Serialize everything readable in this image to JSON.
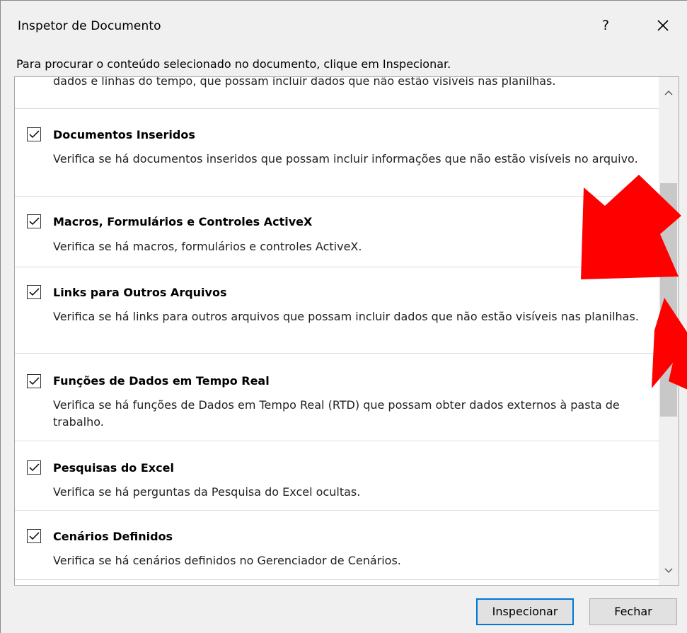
{
  "window": {
    "title": "Inspetor de Documento",
    "help_label": "?"
  },
  "instructions": "Para procurar o conteúdo selecionado no documento, clique em Inspecionar.",
  "list": {
    "cut_text": "dados e linhas do tempo, que possam incluir dados que não estão visíveis nas planilhas.",
    "items": [
      {
        "title": "Documentos Inseridos",
        "description": "Verifica se há documentos inseridos que possam incluir informações que não estão visíveis no arquivo.",
        "checked": true
      },
      {
        "title": "Macros, Formulários e Controles ActiveX",
        "description": "Verifica se há macros, formulários e controles ActiveX.",
        "checked": true
      },
      {
        "title": "Links para Outros Arquivos",
        "description": "Verifica se há links para outros arquivos que possam incluir dados que não estão visíveis nas planilhas.",
        "checked": true
      },
      {
        "title": "Funções de Dados em Tempo Real",
        "description": "Verifica se há funções de Dados em Tempo Real (RTD) que possam obter dados externos à pasta de trabalho.",
        "checked": true
      },
      {
        "title": "Pesquisas do Excel",
        "description": "Verifica se há perguntas da Pesquisa do Excel ocultas.",
        "checked": true
      },
      {
        "title": "Cenários Definidos",
        "description": "Verifica se há cenários definidos no Gerenciador de Cenários.",
        "checked": true
      }
    ]
  },
  "buttons": {
    "inspect": "Inspecionar",
    "close": "Fechar"
  },
  "colors": {
    "annotation_arrow": "#ff0000",
    "primary_border": "#0078d7"
  },
  "icons": {
    "close": "close-icon",
    "check": "checkmark-icon",
    "scroll_up": "chevron-up-icon",
    "scroll_down": "chevron-down-icon"
  }
}
